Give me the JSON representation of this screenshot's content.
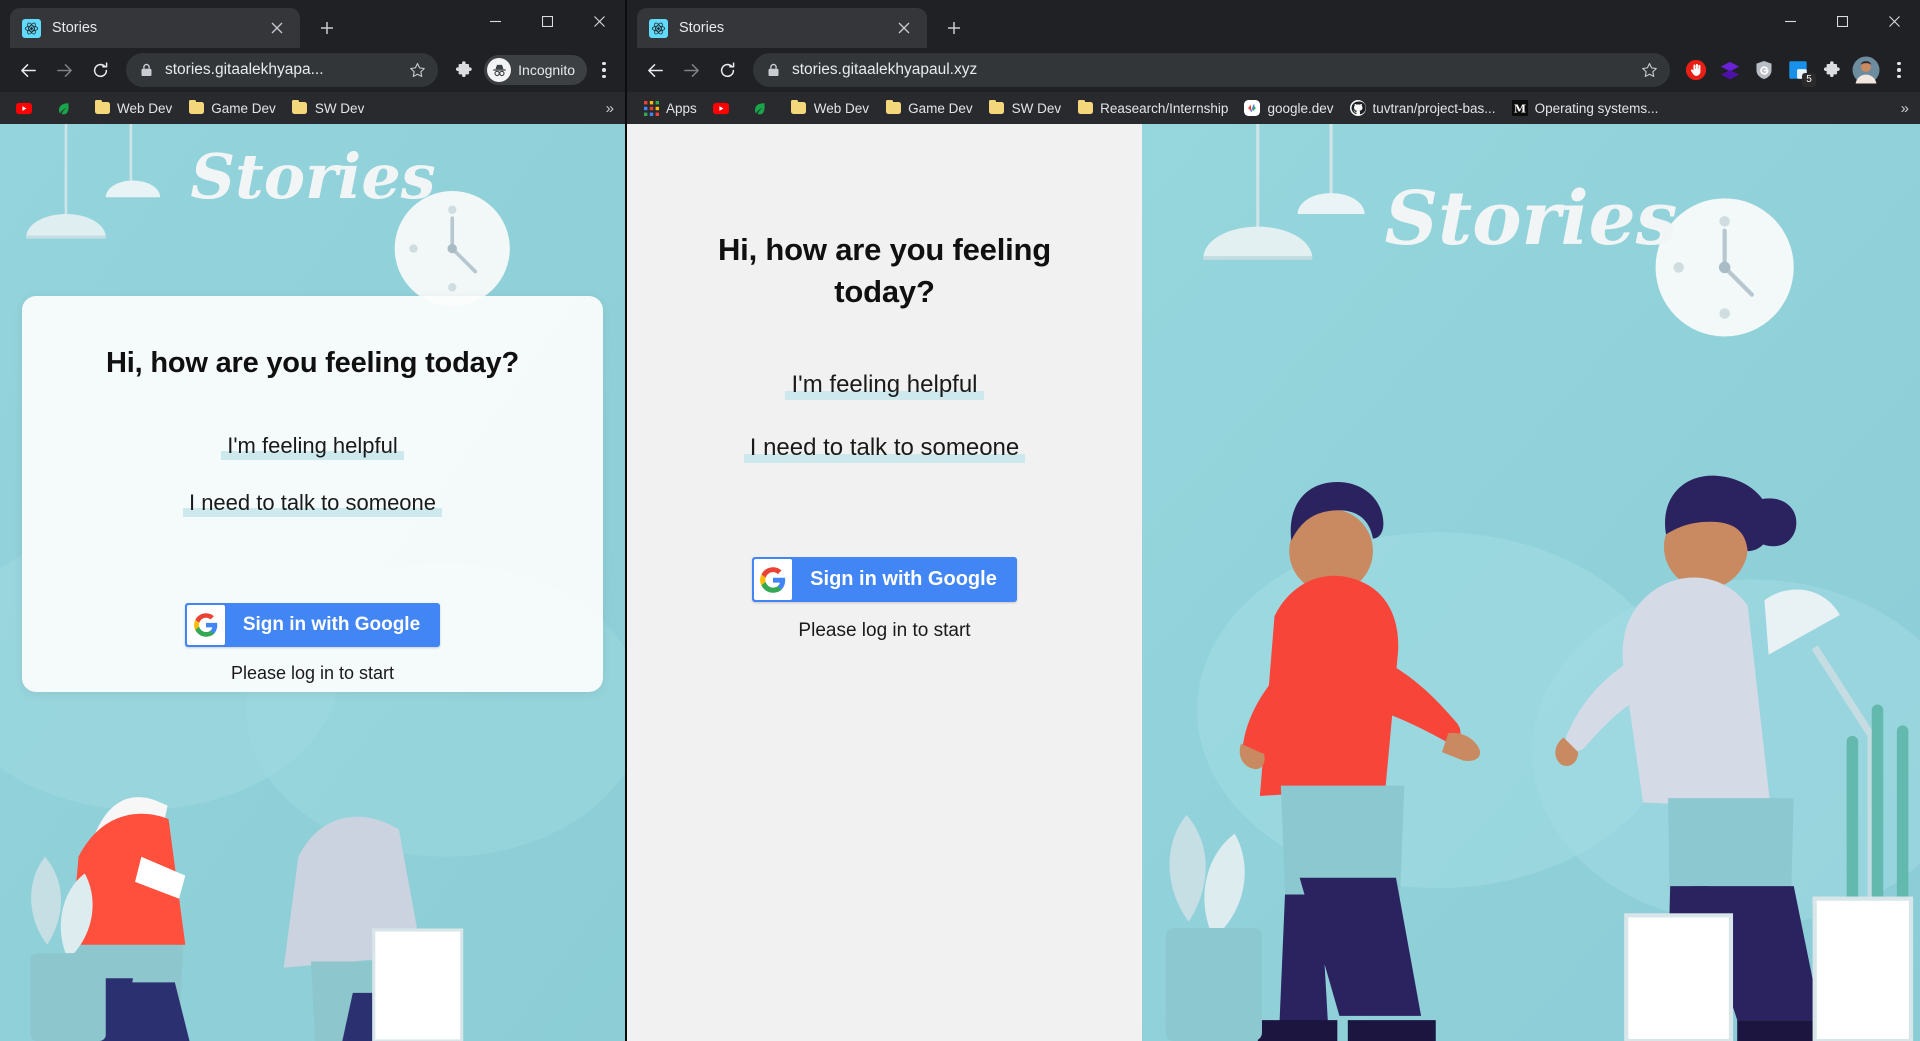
{
  "windows": {
    "left": {
      "tab": {
        "title": "Stories",
        "favicon_icon": "react-logo-icon",
        "close_icon": "close-icon"
      },
      "newtab_icon": "plus-icon",
      "window_controls": {
        "minimize": "minimize-icon",
        "maximize": "maximize-icon",
        "close": "close-icon"
      },
      "toolbar": {
        "back_icon": "back-arrow-icon",
        "forward_icon": "forward-arrow-icon",
        "reload_icon": "reload-icon",
        "lock_icon": "lock-icon",
        "url": "stories.gitaalekhyapa...",
        "bookmark_star_icon": "star-icon",
        "extensions_icon": "puzzle-piece-icon",
        "profile_label": "Incognito",
        "profile_icon": "incognito-hat-icon",
        "menu_icon": "three-dot-menu-icon"
      },
      "bookmarks": [
        {
          "label": "",
          "icon": "youtube-icon"
        },
        {
          "label": "",
          "icon": "leaf-icon"
        },
        {
          "label": "Web Dev",
          "icon": "folder-icon"
        },
        {
          "label": "Game Dev",
          "icon": "folder-icon"
        },
        {
          "label": "SW Dev",
          "icon": "folder-icon"
        }
      ],
      "bookmarks_overflow_icon": "chevron-double-right-icon"
    },
    "right": {
      "tab": {
        "title": "Stories",
        "favicon_icon": "react-logo-icon",
        "close_icon": "close-icon"
      },
      "newtab_icon": "plus-icon",
      "window_controls": {
        "minimize": "minimize-icon",
        "maximize": "maximize-icon",
        "close": "close-icon"
      },
      "toolbar": {
        "back_icon": "back-arrow-icon",
        "forward_icon": "forward-arrow-icon",
        "reload_icon": "reload-icon",
        "lock_icon": "lock-icon",
        "url": "stories.gitaalekhyapaul.xyz",
        "bookmark_star_icon": "star-icon",
        "ext_ublock_icon": "ublock-origin-icon",
        "ext_layers_icon": "purple-layers-icon",
        "ext_shield_icon": "shield-icon",
        "ext_window_icon": "window-manager-icon",
        "ext_window_badge": "5",
        "extensions_icon": "puzzle-piece-icon",
        "profile_icon": "user-avatar-icon",
        "menu_icon": "three-dot-menu-icon"
      },
      "bookmarks": [
        {
          "label": "Apps",
          "icon": "apps-grid-icon"
        },
        {
          "label": "",
          "icon": "youtube-icon"
        },
        {
          "label": "",
          "icon": "leaf-icon"
        },
        {
          "label": "Web Dev",
          "icon": "folder-icon"
        },
        {
          "label": "Game Dev",
          "icon": "folder-icon"
        },
        {
          "label": "SW Dev",
          "icon": "folder-icon"
        },
        {
          "label": "Reasearch/Internship",
          "icon": "folder-icon"
        },
        {
          "label": "google.dev",
          "icon": "google-dev-icon"
        },
        {
          "label": "tuvtran/project-bas...",
          "icon": "github-icon"
        },
        {
          "label": "Operating systems...",
          "icon": "medium-m-icon"
        }
      ],
      "bookmarks_overflow_icon": "chevron-double-right-icon"
    }
  },
  "page": {
    "brand": "Stories",
    "heading": "Hi, how are you feeling today?",
    "options": [
      "I'm feeling helpful",
      "I need to talk to someone"
    ],
    "signin_button": {
      "label": "Sign in with Google",
      "icon": "google-g-icon"
    },
    "hint": "Please log in to start"
  },
  "colors": {
    "accent_blue": "#4285f4",
    "page_bg_teal": "#8ed2da",
    "card_bg": "#fbfcfc",
    "option_highlight": "#cde9ed",
    "chrome_dark": "#202124",
    "bookmark_bar": "#292a2d",
    "omnibox": "#323639",
    "tab_active": "#35363a",
    "pane_gray": "#f1f1f1"
  }
}
